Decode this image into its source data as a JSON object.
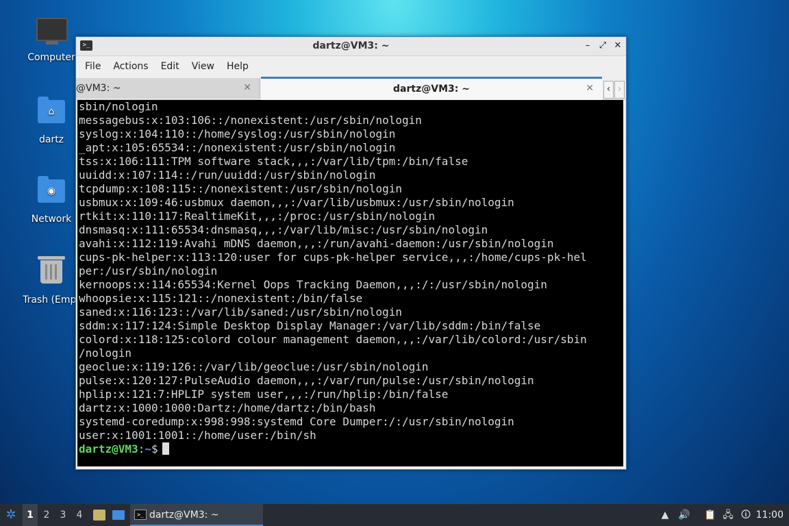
{
  "desktop": {
    "icons": [
      {
        "label": "Computer"
      },
      {
        "label": "dartz"
      },
      {
        "label": "Network"
      },
      {
        "label": "Trash (Empt"
      }
    ]
  },
  "window": {
    "title": "dartz@VM3: ~",
    "menu": [
      "File",
      "Actions",
      "Edit",
      "View",
      "Help"
    ],
    "tabs": [
      {
        "label": "@VM3: ~"
      },
      {
        "label": "dartz@VM3: ~"
      }
    ]
  },
  "terminal": {
    "lines": [
      "sbin/nologin",
      "messagebus:x:103:106::/nonexistent:/usr/sbin/nologin",
      "syslog:x:104:110::/home/syslog:/usr/sbin/nologin",
      "_apt:x:105:65534::/nonexistent:/usr/sbin/nologin",
      "tss:x:106:111:TPM software stack,,,:/var/lib/tpm:/bin/false",
      "uuidd:x:107:114::/run/uuidd:/usr/sbin/nologin",
      "tcpdump:x:108:115::/nonexistent:/usr/sbin/nologin",
      "usbmux:x:109:46:usbmux daemon,,,:/var/lib/usbmux:/usr/sbin/nologin",
      "rtkit:x:110:117:RealtimeKit,,,:/proc:/usr/sbin/nologin",
      "dnsmasq:x:111:65534:dnsmasq,,,:/var/lib/misc:/usr/sbin/nologin",
      "avahi:x:112:119:Avahi mDNS daemon,,,:/run/avahi-daemon:/usr/sbin/nologin",
      "cups-pk-helper:x:113:120:user for cups-pk-helper service,,,:/home/cups-pk-hel",
      "per:/usr/sbin/nologin",
      "kernoops:x:114:65534:Kernel Oops Tracking Daemon,,,:/:/usr/sbin/nologin",
      "whoopsie:x:115:121::/nonexistent:/bin/false",
      "saned:x:116:123::/var/lib/saned:/usr/sbin/nologin",
      "sddm:x:117:124:Simple Desktop Display Manager:/var/lib/sddm:/bin/false",
      "colord:x:118:125:colord colour management daemon,,,:/var/lib/colord:/usr/sbin",
      "/nologin",
      "geoclue:x:119:126::/var/lib/geoclue:/usr/sbin/nologin",
      "pulse:x:120:127:PulseAudio daemon,,,:/var/run/pulse:/usr/sbin/nologin",
      "hplip:x:121:7:HPLIP system user,,,:/run/hplip:/bin/false",
      "dartz:x:1000:1000:Dartz:/home/dartz:/bin/bash",
      "systemd-coredump:x:998:998:systemd Core Dumper:/:/usr/sbin/nologin",
      "user:x:1001:1001::/home/user:/bin/sh"
    ],
    "prompt": {
      "user_host": "dartz@VM3",
      "sep": ":",
      "path": "~",
      "symbol": "$"
    }
  },
  "taskbar": {
    "workspaces": [
      "1",
      "2",
      "3",
      "4"
    ],
    "active_workspace": "1",
    "task_label": "dartz@VM3: ~",
    "clock": "11:00"
  },
  "colors": {
    "prompt_user": "#5fd75f",
    "prompt_path": "#5f87ff",
    "accent": "#3d7fc0"
  }
}
